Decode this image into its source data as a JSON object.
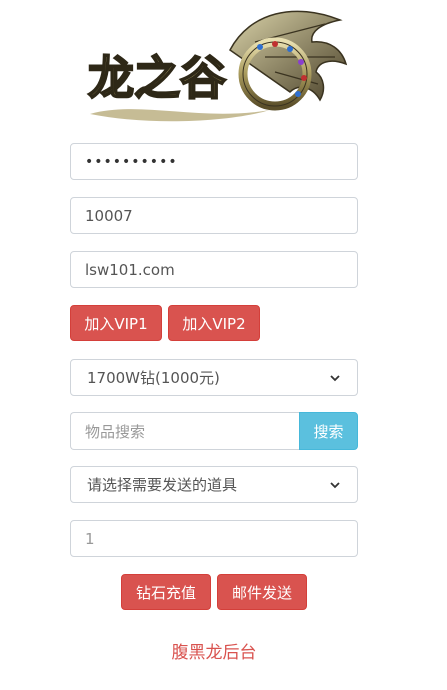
{
  "logo": {
    "text": "龙之谷"
  },
  "form": {
    "password_value": "••••••••••",
    "account_value": "10007",
    "server_value": "lsw101.com",
    "vip1_label": "加入VIP1",
    "vip2_label": "加入VIP2",
    "diamond_selected": "1700W钻(1000元)",
    "item_search_placeholder": "物品搜索",
    "search_label": "搜索",
    "item_select_placeholder": "请选择需要发送的道具",
    "quantity_value": "1",
    "recharge_label": "钻石充值",
    "mail_label": "邮件发送"
  },
  "footer": {
    "link_text": "腹黑龙后台"
  },
  "colors": {
    "danger": "#d9534f",
    "info": "#5bc0de"
  }
}
